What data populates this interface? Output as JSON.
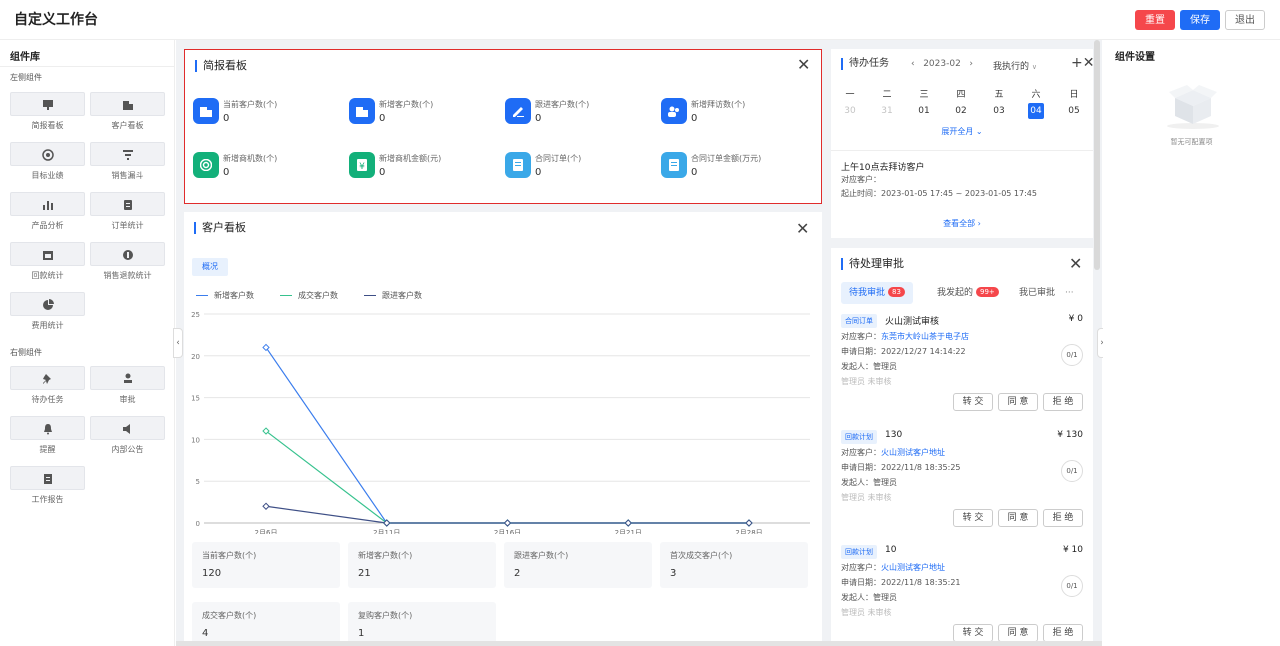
{
  "header": {
    "title": "自定义工作台",
    "reset": "重置",
    "save": "保存",
    "exit": "退出"
  },
  "library": {
    "title": "组件库",
    "left_group": "左侧组件",
    "left_items": [
      "简报看板",
      "客户看板",
      "目标业绩",
      "销售漏斗",
      "产品分析",
      "订单统计",
      "回款统计",
      "销售退款统计",
      "费用统计"
    ],
    "right_group": "右侧组件",
    "right_items": [
      "待办任务",
      "审批",
      "提醒",
      "内部公告",
      "工作报告"
    ]
  },
  "brief": {
    "title": "简报看板",
    "metrics": [
      {
        "label": "当前客户数(个)",
        "value": "0",
        "color": "#1f6cf5"
      },
      {
        "label": "新增客户数(个)",
        "value": "0",
        "color": "#1f6cf5"
      },
      {
        "label": "跟进客户数(个)",
        "value": "0",
        "color": "#1f6cf5"
      },
      {
        "label": "新增拜访数(个)",
        "value": "0",
        "color": "#1f6cf5"
      },
      {
        "label": "新增商机数(个)",
        "value": "0",
        "color": "#13b07a"
      },
      {
        "label": "新增商机金额(元)",
        "value": "0",
        "color": "#13b07a"
      },
      {
        "label": "合同订单(个)",
        "value": "0",
        "color": "#3aa8e8"
      },
      {
        "label": "合同订单金额(万元)",
        "value": "0",
        "color": "#3aa8e8"
      }
    ]
  },
  "customer": {
    "title": "客户看板",
    "tab": "概况",
    "stats": [
      {
        "label": "当前客户数(个)",
        "value": "120"
      },
      {
        "label": "新增客户数(个)",
        "value": "21"
      },
      {
        "label": "跟进客户数(个)",
        "value": "2"
      },
      {
        "label": "首次成交客户(个)",
        "value": "3"
      },
      {
        "label": "成交客户数(个)",
        "value": "4"
      },
      {
        "label": "复购客户数(个)",
        "value": "1"
      }
    ]
  },
  "chart_data": {
    "type": "line",
    "categories": [
      "2月6日",
      "2月11日",
      "2月16日",
      "2月21日",
      "2月28日"
    ],
    "series": [
      {
        "name": "新增客户数",
        "values": [
          21,
          0,
          0,
          0,
          0
        ],
        "color": "#3b7ded"
      },
      {
        "name": "成交客户数",
        "values": [
          11,
          0,
          0,
          0,
          0
        ],
        "color": "#37c28e"
      },
      {
        "name": "跟进客户数",
        "values": [
          2,
          0,
          0,
          0,
          0
        ],
        "color": "#3e4f86"
      }
    ],
    "yticks": [
      "0",
      "5",
      "10",
      "15",
      "20",
      "25"
    ],
    "ylim": [
      0,
      25
    ],
    "grid": true,
    "legend": "top-left"
  },
  "todo": {
    "title": "待办任务",
    "prev": "‹",
    "next": "›",
    "month": "2023-02",
    "filter": "我执行的",
    "add": "+",
    "close": "✕",
    "weekdays": [
      "一",
      "二",
      "三",
      "四",
      "五",
      "六",
      "日"
    ],
    "days": [
      "30",
      "31",
      "01",
      "02",
      "03",
      "04",
      "05"
    ],
    "expand": "展开全月",
    "item_title": "上午10点去拜访客户",
    "customer_label": "对应客户：",
    "time_label": "起止时间：",
    "time_value": "2023-01-05 17:45 ~ 2023-01-05 17:45",
    "view_all": "查看全部"
  },
  "approval": {
    "title": "待处理审批",
    "tabs": [
      {
        "label": "待我审批",
        "badge": "83"
      },
      {
        "label": "我发起的",
        "badge": "99+"
      },
      {
        "label": "我已审批",
        "badge": ""
      }
    ],
    "more": "···",
    "labels": {
      "customer": "对应客户：",
      "date": "申请日期：",
      "initiator": "发起人："
    },
    "actions": {
      "transfer": "转 交",
      "agree": "同 意",
      "reject": "拒 绝"
    },
    "items": [
      {
        "tag": "合同订单",
        "name": "火山测试审核",
        "amount": "¥ 0",
        "customer": "东莞市大岭山茶于电子店",
        "date": "2022/12/27 14:14:22",
        "initiator": "管理员",
        "status": "管理员 未审核",
        "progress": "0/1"
      },
      {
        "tag": "回款计划",
        "name": "130",
        "amount": "¥ 130",
        "customer": "火山测试客户地址",
        "date": "2022/11/8 18:35:25",
        "initiator": "管理员",
        "status": "管理员 未审核",
        "progress": "0/1"
      },
      {
        "tag": "回款计划",
        "name": "10",
        "amount": "¥ 10",
        "customer": "火山测试客户地址",
        "date": "2022/11/8 18:35:21",
        "initiator": "管理员",
        "status": "管理员 未审核",
        "progress": "0/1"
      }
    ]
  },
  "settings": {
    "title": "组件设置",
    "empty": "暂无可配置项"
  }
}
